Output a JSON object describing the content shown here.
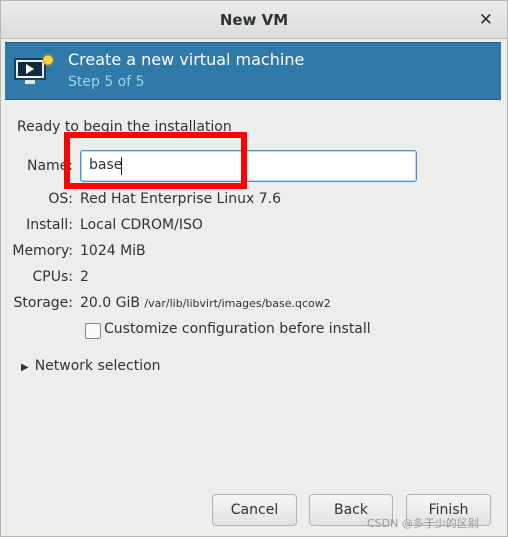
{
  "window": {
    "title": "New VM",
    "close_icon": "close-icon"
  },
  "banner": {
    "title": "Create a new virtual machine",
    "subtitle": "Step 5 of 5",
    "icon": "vm-monitor-icon"
  },
  "ready_text": "Ready to begin the installation",
  "fields": {
    "name": {
      "label": "Name:",
      "value": "base"
    },
    "os": {
      "label": "OS:",
      "value": "Red Hat Enterprise Linux 7.6"
    },
    "install": {
      "label": "Install:",
      "value": "Local CDROM/ISO"
    },
    "memory": {
      "label": "Memory:",
      "value": "1024 MiB"
    },
    "cpus": {
      "label": "CPUs:",
      "value": "2"
    },
    "storage": {
      "label": "Storage:",
      "size": "20.0 GiB",
      "path": "/var/lib/libvirt/images/base.qcow2"
    }
  },
  "customize": {
    "label": "Customize configuration before install",
    "checked": false
  },
  "network": {
    "label": "Network selection",
    "expanded": false
  },
  "buttons": {
    "cancel": "Cancel",
    "back": "Back",
    "finish": "Finish"
  },
  "watermark": "CSDN @多于少的区别",
  "colors": {
    "banner": "#2f7aa8",
    "highlight": "#ff0000"
  }
}
